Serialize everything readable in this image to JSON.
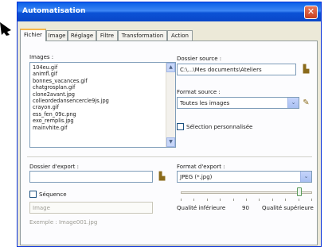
{
  "window": {
    "title": "Automatisation",
    "close_glyph": "✕"
  },
  "tabs": [
    {
      "label": "Fichier",
      "active": true
    },
    {
      "label": "Image",
      "active": false
    },
    {
      "label": "Réglage",
      "active": false
    },
    {
      "label": "Filtre",
      "active": false
    },
    {
      "label": "Transformation",
      "active": false
    },
    {
      "label": "Action",
      "active": false
    }
  ],
  "images": {
    "label": "Images :",
    "items": [
      "104eu.gif",
      "animfl.gif",
      "bonnes_vacances.gif",
      "chatgrosplan.gif",
      "clone2avant.jpg",
      "colleordedansencercle9js.jpg",
      "crayon.gif",
      "ess_fen_09c.png",
      "exo_remplis.jpg",
      "mainvhite.gif"
    ]
  },
  "source": {
    "folder_label": "Dossier source :",
    "folder_value": "C:\\...\\Mes documents\\Ateliers",
    "format_label": "Format source :",
    "format_value": "Toutes les images",
    "custom_selection_label": "Sélection personnalisée",
    "custom_selection_checked": false
  },
  "export": {
    "folder_label": "Dossier d'export :",
    "folder_value": "",
    "sequence_label": "Séquence",
    "sequence_checked": false,
    "sequence_input_value": "Image",
    "example_text": "Exemple : Image001.jpg",
    "format_label": "Format d'export :",
    "format_value": "JPEG (*.jpg)",
    "quality_low_label": "Qualité inférieure",
    "quality_value": "90",
    "quality_high_label": "Qualité supérieure",
    "quality_fraction": 0.9
  },
  "icons": {
    "browse_source": "folder-browse-icon",
    "browse_export": "folder-browse-icon",
    "edit_format": "edit-pencil-icon",
    "dropdown": "chevron-down-icon",
    "scroll_up": "scroll-up-icon",
    "scroll_down": "scroll-down-icon"
  },
  "colors": {
    "title_bar": "#0a5fe8",
    "close_button": "#c8401f",
    "tab_active_accent": "#f7b64a"
  }
}
